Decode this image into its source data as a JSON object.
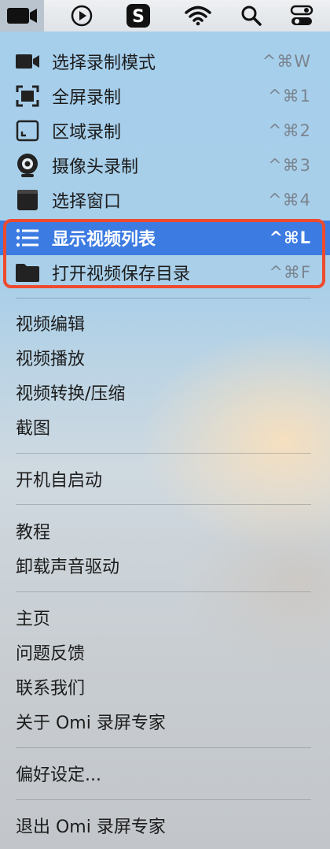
{
  "menubar": {
    "icons": [
      "video-camera-icon",
      "play-circle-icon",
      "s-app-icon",
      "wifi-icon",
      "search-icon",
      "control-center-icon"
    ]
  },
  "menu": {
    "record": [
      {
        "label": "选择录制模式",
        "shortcut": "^⌘W"
      },
      {
        "label": "全屏录制",
        "shortcut": "^⌘1"
      },
      {
        "label": "区域录制",
        "shortcut": "^⌘2"
      },
      {
        "label": "摄像头录制",
        "shortcut": "^⌘3"
      },
      {
        "label": "选择窗口",
        "shortcut": "^⌘4"
      }
    ],
    "video_list": {
      "label": "显示视频列表",
      "shortcut": "^⌘L"
    },
    "open_folder": {
      "label": "打开视频保存目录",
      "shortcut": "^⌘F"
    },
    "tools": [
      "视频编辑",
      "视频播放",
      "视频转换/压缩",
      "截图"
    ],
    "startup": "开机自启动",
    "help": [
      "教程",
      "卸载声音驱动"
    ],
    "about": [
      "主页",
      "问题反馈",
      "联系我们",
      "关于 Omi 录屏专家"
    ],
    "preferences": "偏好设定...",
    "quit": "退出 Omi 录屏专家"
  },
  "colors": {
    "highlight": "#3c7be2",
    "annotation": "#ee4a2e"
  }
}
